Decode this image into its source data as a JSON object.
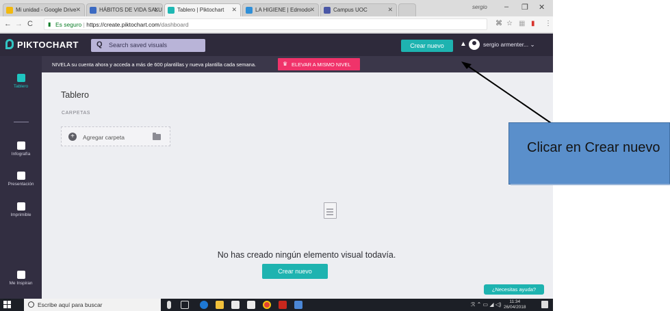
{
  "browser": {
    "tabs": [
      {
        "label": "Mi unidad - Google Drive",
        "favicon_color": "#f2b90f"
      },
      {
        "label": "HÁBITOS DE VIDA SALUD",
        "favicon_color": "#3b6ac2"
      },
      {
        "label": "Tablero | Piktochart",
        "favicon_color": "#1fb8b4"
      },
      {
        "label": "LA HIGIENE | Edmodo",
        "favicon_color": "#2f8fd8"
      },
      {
        "label": "Campus UOC",
        "favicon_color": "#4a57a6"
      }
    ],
    "profile_name": "sergio",
    "secure_label": "Es seguro",
    "url_base": "https://create.piktochart.com",
    "url_path": "/dashboard"
  },
  "app": {
    "logo": "PIKTOCHART",
    "search_placeholder": "Search saved visuals",
    "create_button": "Crear nuevo",
    "user_name": "sergio armenter...",
    "sidebar": [
      {
        "label": "Tablero",
        "icon": "grid-icon"
      },
      {
        "label": "Infografía",
        "icon": "infographic-icon"
      },
      {
        "label": "Presentación",
        "icon": "presentation-icon"
      },
      {
        "label": "Imprimible",
        "icon": "printable-icon"
      },
      {
        "label": "Me Inspiran",
        "icon": "star-icon"
      }
    ],
    "promo_text": "NIVELA su cuenta ahora y acceda a más de 600 plantillas y nueva plantilla cada semana.",
    "promo_button": "ELEVAR A MISMO NIVEL",
    "page_title": "Tablero",
    "folders_label": "CARPETAS",
    "add_folder": "Agregar carpeta",
    "empty_message": "No has creado ningún elemento visual todavía.",
    "empty_button": "Crear nuevo",
    "help_button": "¿Necesitas ayuda?"
  },
  "taskbar": {
    "search_placeholder": "Escribe aquí para buscar",
    "time": "11:34",
    "date": "26/04/2018"
  },
  "annotation": {
    "callout_text": "Clicar en Crear nuevo"
  },
  "colors": {
    "accent": "#1eb3b0",
    "nav_dark": "#2e2a3b",
    "promo_pink": "#f0336a",
    "callout_blue": "#5a8fcb"
  }
}
